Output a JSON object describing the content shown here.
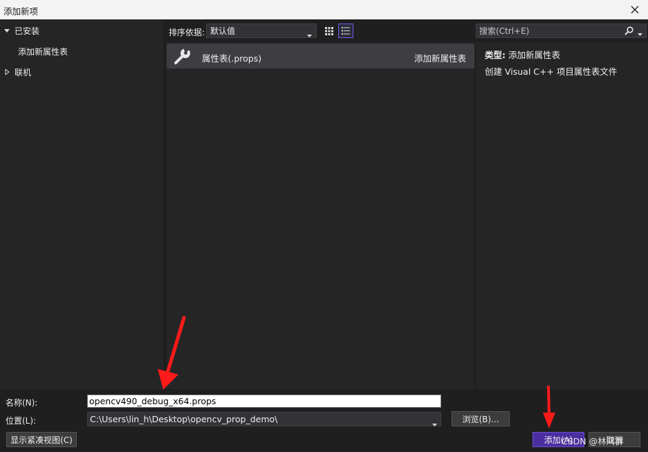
{
  "window": {
    "title": "添加新项",
    "close_icon": "close-icon"
  },
  "tree": {
    "items": [
      {
        "label": "已安装",
        "expanded": true,
        "icon": "caret-down-icon"
      },
      {
        "label": "添加新属性表",
        "selected": true
      },
      {
        "label": "联机",
        "expanded": false,
        "icon": "caret-right-icon"
      }
    ]
  },
  "toolbar": {
    "sort_label": "排序依据:",
    "sort_value": "默认值",
    "view_grid_icon": "grid-view-icon",
    "view_list_icon": "list-view-icon"
  },
  "search": {
    "placeholder": "搜索(Ctrl+E)",
    "icon": "search-icon"
  },
  "templates": [
    {
      "name": "属性表(.props)",
      "language": "添加新属性表",
      "icon": "wrench-icon"
    }
  ],
  "details": {
    "type_label": "类型:",
    "type_value": "添加新属性表",
    "description": "创建 Visual C++ 项目属性表文件"
  },
  "form": {
    "name_label": "名称(N):",
    "name_value": "opencv490_debug_x64.props",
    "location_label": "位置(L):",
    "location_value": "C:\\Users\\lin_h\\Desktop\\opencv_prop_demo\\",
    "browse_label": "浏览(B)..."
  },
  "buttons": {
    "compact_view": "显示紧凑视图(C)",
    "add": "添加(A)",
    "cancel": "取消"
  },
  "watermark": "CSDN @林鸿群",
  "colors": {
    "accent": "#6c5ce7",
    "add_button": "#4b2fa0",
    "annotation_arrow": "#ff1a1a"
  }
}
